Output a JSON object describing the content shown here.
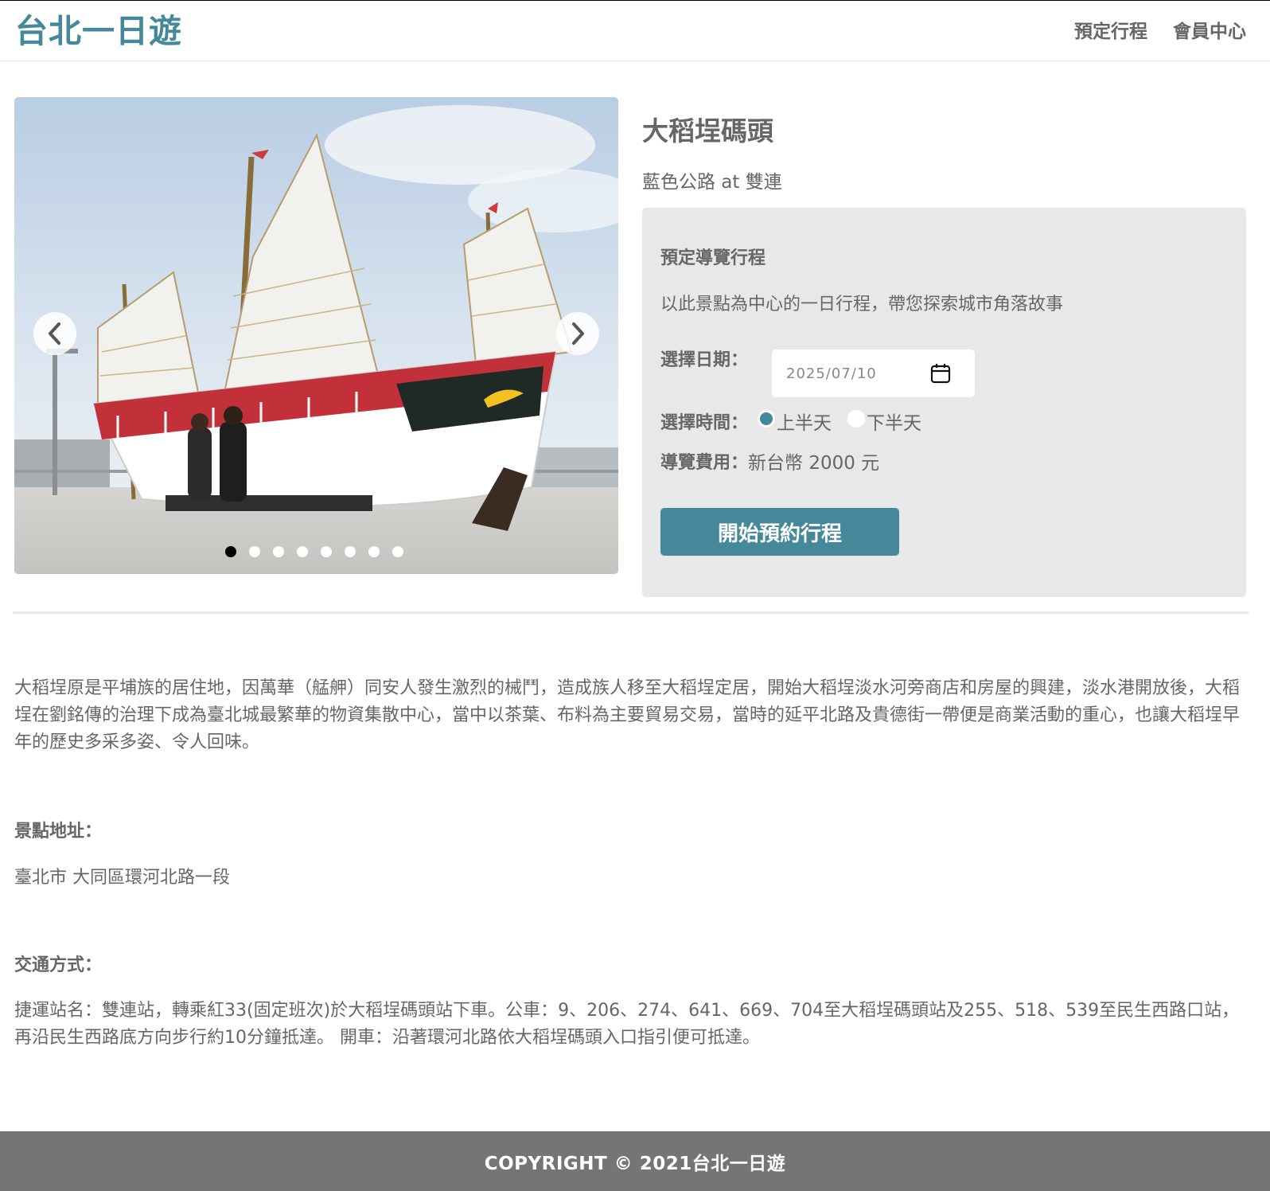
{
  "header": {
    "brand": "台北一日遊",
    "nav": [
      {
        "label": "預定行程"
      },
      {
        "label": "會員中心"
      }
    ]
  },
  "carousel": {
    "slide_count": 8,
    "active_index": 0,
    "prev_icon": "chevron-left-icon",
    "next_icon": "chevron-right-icon"
  },
  "attraction": {
    "name": "大稻埕碼頭",
    "category_line": "藍色公路 at 雙連"
  },
  "booking": {
    "title": "預定導覽行程",
    "description": "以此景點為中心的一日行程，帶您探索城市角落故事",
    "date_label": "選擇日期：",
    "date_value": "2025/07/10",
    "time_label": "選擇時間：",
    "time_options": [
      {
        "label": "上半天",
        "checked": true
      },
      {
        "label": "下半天",
        "checked": false
      }
    ],
    "fee_label": "導覽費用：",
    "fee_value": "新台幣 2000 元",
    "submit_label": "開始預約行程",
    "accent_color": "#448899"
  },
  "details": {
    "description": "大稻埕原是平埔族的居住地，因萬華（艋舺）同安人發生激烈的械鬥，造成族人移至大稻埕定居，開始大稻埕淡水河旁商店和房屋的興建，淡水港開放後，大稻埕在劉銘傳的治理下成為臺北城最繁華的物資集散中心，當中以茶葉、布料為主要貿易交易，當時的延平北路及貴德街一帶便是商業活動的重心，也讓大稻埕早年的歷史多采多姿、令人回味。",
    "address_title": "景點地址：",
    "address": "臺北市  大同區環河北路一段",
    "transport_title": "交通方式：",
    "transport": "捷運站名：雙連站，轉乘紅33(固定班次)於大稻埕碼頭站下車。公車：9、206、274、641、669、704至大稻埕碼頭站及255、518、539至民生西路口站，再沿民生西路底方向步行約10分鐘抵達。 開車：沿著環河北路依大稻埕碼頭入口指引便可抵達。"
  },
  "footer": {
    "copyright": "COPYRIGHT © 2021台北一日遊"
  }
}
